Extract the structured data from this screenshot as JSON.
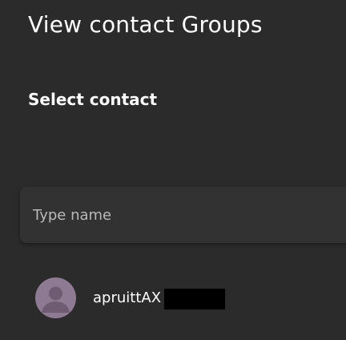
{
  "header": {
    "title": "View contact Groups"
  },
  "selection": {
    "label": "Select contact"
  },
  "search": {
    "placeholder": "Type name",
    "value": ""
  },
  "contacts": [
    {
      "name": "apruittAX",
      "avatar_icon": "person-icon",
      "avatar_color": "#8e7a92",
      "redacted_suffix": true
    }
  ],
  "colors": {
    "background": "#2b2b2b",
    "input_background": "#323232",
    "text": "#ffffff",
    "placeholder": "#b9b9b9",
    "avatar_background": "#8e7a92",
    "avatar_figure": "#6e5d72"
  }
}
